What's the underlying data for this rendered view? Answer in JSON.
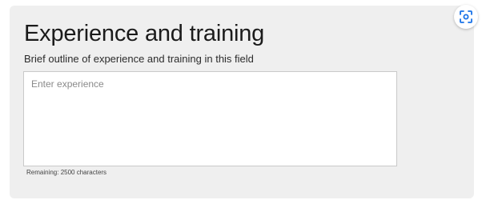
{
  "section": {
    "title": "Experience and training",
    "subtitle": "Brief outline of experience and training in this field"
  },
  "experience_field": {
    "placeholder": "Enter experience",
    "value": ""
  },
  "counter": {
    "text": "Remaining: 2500 characters"
  },
  "scan_button": {
    "icon": "scan-icon",
    "color": "#1a73e8"
  }
}
